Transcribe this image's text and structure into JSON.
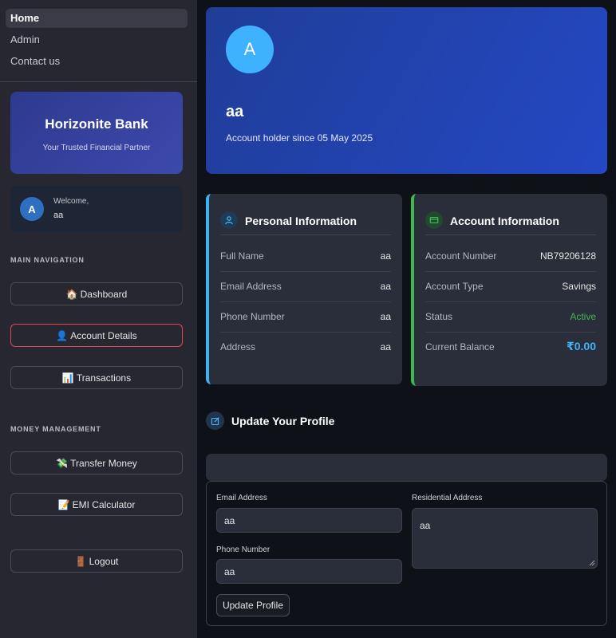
{
  "sidebar": {
    "pages": [
      {
        "label": "Home",
        "active": true
      },
      {
        "label": "Admin",
        "active": false
      },
      {
        "label": "Contact us",
        "active": false
      }
    ],
    "brand": {
      "title": "Horizonite Bank",
      "subtitle": "Your Trusted Financial Partner"
    },
    "welcome": {
      "avatar_letter": "A",
      "label": "Welcome,",
      "name": "aa"
    },
    "main_nav_label": "MAIN NAVIGATION",
    "main_nav": [
      {
        "emoji": "🏠",
        "label": "Dashboard"
      },
      {
        "emoji": "👤",
        "label": "Account Details"
      },
      {
        "emoji": "📊",
        "label": "Transactions"
      }
    ],
    "money_label": "MONEY MANAGEMENT",
    "money_nav": [
      {
        "emoji": "💸",
        "label": "Transfer Money"
      },
      {
        "emoji": "📝",
        "label": "EMI Calculator"
      }
    ],
    "logout": {
      "emoji": "🚪",
      "label": "Logout"
    }
  },
  "hero": {
    "avatar_letter": "A",
    "name": "aa",
    "since": "Account holder since 05 May 2025"
  },
  "personal": {
    "title": "Personal Information",
    "rows": [
      {
        "key": "Full Name",
        "value": "aa"
      },
      {
        "key": "Email Address",
        "value": "aa"
      },
      {
        "key": "Phone Number",
        "value": "aa"
      },
      {
        "key": "Address",
        "value": "aa"
      }
    ]
  },
  "account": {
    "title": "Account Information",
    "rows": [
      {
        "key": "Account Number",
        "value": "NB79206128"
      },
      {
        "key": "Account Type",
        "value": "Savings"
      },
      {
        "key": "Status",
        "value": "Active"
      },
      {
        "key": "Current Balance",
        "value": "₹0.00"
      }
    ]
  },
  "update": {
    "title": "Update Your Profile",
    "email_label": "Email Address",
    "email_value": "aa",
    "phone_label": "Phone Number",
    "phone_value": "aa",
    "address_label": "Residential Address",
    "address_value": "aa",
    "submit_label": "Update Profile"
  },
  "colors": {
    "accent_blue": "#3cb3f0",
    "accent_green": "#3fb850",
    "active_red": "#e0464f",
    "hero_blue": "#2448c4"
  }
}
